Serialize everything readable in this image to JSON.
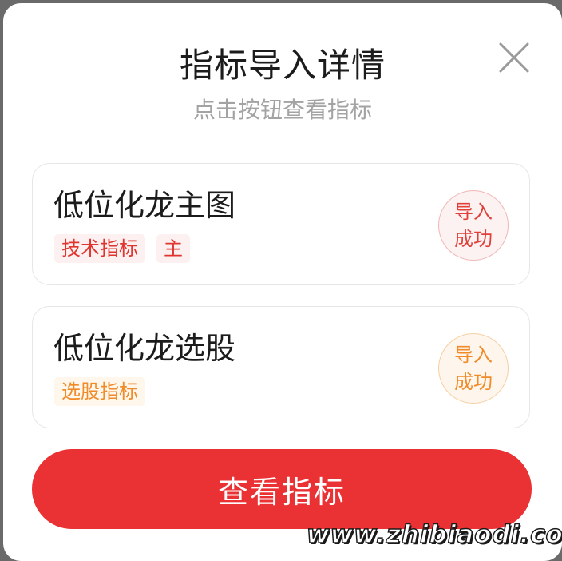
{
  "dialog": {
    "title": "指标导入详情",
    "subtitle": "点击按钮查看指标",
    "close_icon": "close-icon"
  },
  "cards": [
    {
      "name": "低位化龙主图",
      "tags": [
        "技术指标",
        "主"
      ],
      "status": [
        "导入",
        "成功"
      ],
      "accent": "#e0352f"
    },
    {
      "name": "低位化龙选股",
      "tags": [
        "选股指标"
      ],
      "status": [
        "导入",
        "成功"
      ],
      "accent": "#f08b28"
    }
  ],
  "primary_button": {
    "label": "查看指标",
    "color": "#ea3134"
  },
  "watermark": "www.zhibiaodi.com"
}
